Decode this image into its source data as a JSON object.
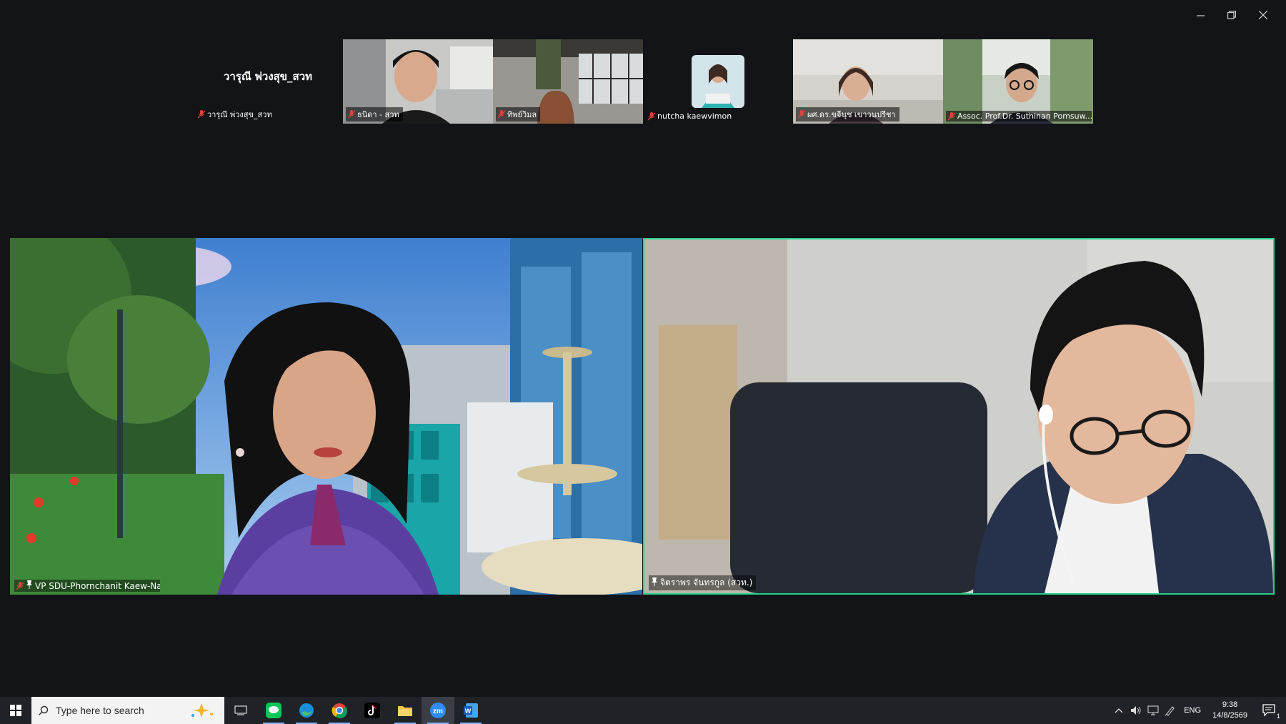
{
  "window": {
    "controls": [
      "minimize",
      "restore",
      "close"
    ]
  },
  "gallery": [
    {
      "name": "วารุณี พ่วงสุข_สวท",
      "display": "วารุณี พ่วงสุข_สวท",
      "video": false
    },
    {
      "name": "ธนิดา - สวท",
      "video": true
    },
    {
      "name": "ทิพย์วิมล",
      "video": true
    },
    {
      "name": "nutcha kaewvimon",
      "video": false
    },
    {
      "name": "ผศ.ดร.ขจีนุช เขาวนปรีชา",
      "video": true
    },
    {
      "name": "Assoc. Prof.Dr. Suthinan Pomsuw...",
      "video": true
    }
  ],
  "main_tiles": [
    {
      "name": "VP SDU-Phornchanit Kaew-Nate",
      "active_speaker": false
    },
    {
      "name": "จิตราพร จันทรกูล (สวท.)",
      "active_speaker": true
    }
  ],
  "taskbar": {
    "search_placeholder": "Type here to search",
    "apps": [
      "task-view",
      "line",
      "edge",
      "chrome",
      "tiktok",
      "file-explorer",
      "zoom",
      "word"
    ],
    "tray": {
      "language": "ENG",
      "time": "9:38",
      "date": "14/8/2569",
      "notification_count": "1"
    }
  },
  "colors": {
    "background": "#121417",
    "active_speaker_border": "#23d18b",
    "muted_mic": "#e0443a"
  }
}
